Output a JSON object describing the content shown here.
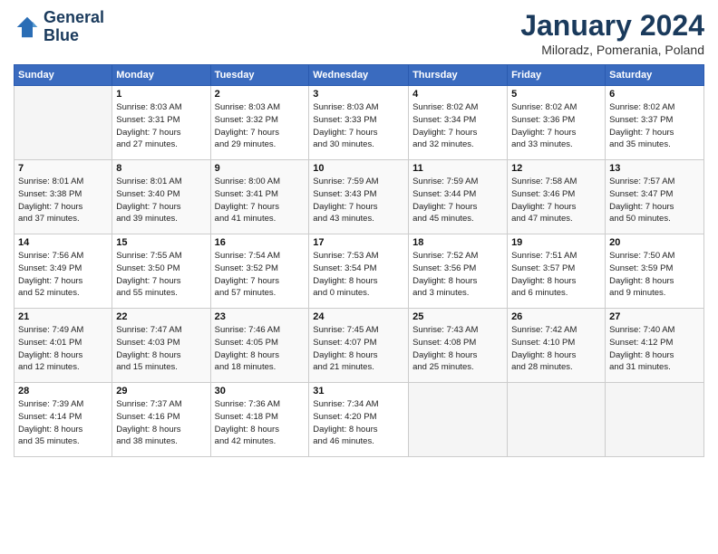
{
  "header": {
    "logo_line1": "General",
    "logo_line2": "Blue",
    "month": "January 2024",
    "location": "Miloradz, Pomerania, Poland"
  },
  "days_of_week": [
    "Sunday",
    "Monday",
    "Tuesday",
    "Wednesday",
    "Thursday",
    "Friday",
    "Saturday"
  ],
  "weeks": [
    [
      {
        "day": "",
        "info": ""
      },
      {
        "day": "1",
        "info": "Sunrise: 8:03 AM\nSunset: 3:31 PM\nDaylight: 7 hours\nand 27 minutes."
      },
      {
        "day": "2",
        "info": "Sunrise: 8:03 AM\nSunset: 3:32 PM\nDaylight: 7 hours\nand 29 minutes."
      },
      {
        "day": "3",
        "info": "Sunrise: 8:03 AM\nSunset: 3:33 PM\nDaylight: 7 hours\nand 30 minutes."
      },
      {
        "day": "4",
        "info": "Sunrise: 8:02 AM\nSunset: 3:34 PM\nDaylight: 7 hours\nand 32 minutes."
      },
      {
        "day": "5",
        "info": "Sunrise: 8:02 AM\nSunset: 3:36 PM\nDaylight: 7 hours\nand 33 minutes."
      },
      {
        "day": "6",
        "info": "Sunrise: 8:02 AM\nSunset: 3:37 PM\nDaylight: 7 hours\nand 35 minutes."
      }
    ],
    [
      {
        "day": "7",
        "info": "Sunrise: 8:01 AM\nSunset: 3:38 PM\nDaylight: 7 hours\nand 37 minutes."
      },
      {
        "day": "8",
        "info": "Sunrise: 8:01 AM\nSunset: 3:40 PM\nDaylight: 7 hours\nand 39 minutes."
      },
      {
        "day": "9",
        "info": "Sunrise: 8:00 AM\nSunset: 3:41 PM\nDaylight: 7 hours\nand 41 minutes."
      },
      {
        "day": "10",
        "info": "Sunrise: 7:59 AM\nSunset: 3:43 PM\nDaylight: 7 hours\nand 43 minutes."
      },
      {
        "day": "11",
        "info": "Sunrise: 7:59 AM\nSunset: 3:44 PM\nDaylight: 7 hours\nand 45 minutes."
      },
      {
        "day": "12",
        "info": "Sunrise: 7:58 AM\nSunset: 3:46 PM\nDaylight: 7 hours\nand 47 minutes."
      },
      {
        "day": "13",
        "info": "Sunrise: 7:57 AM\nSunset: 3:47 PM\nDaylight: 7 hours\nand 50 minutes."
      }
    ],
    [
      {
        "day": "14",
        "info": "Sunrise: 7:56 AM\nSunset: 3:49 PM\nDaylight: 7 hours\nand 52 minutes."
      },
      {
        "day": "15",
        "info": "Sunrise: 7:55 AM\nSunset: 3:50 PM\nDaylight: 7 hours\nand 55 minutes."
      },
      {
        "day": "16",
        "info": "Sunrise: 7:54 AM\nSunset: 3:52 PM\nDaylight: 7 hours\nand 57 minutes."
      },
      {
        "day": "17",
        "info": "Sunrise: 7:53 AM\nSunset: 3:54 PM\nDaylight: 8 hours\nand 0 minutes."
      },
      {
        "day": "18",
        "info": "Sunrise: 7:52 AM\nSunset: 3:56 PM\nDaylight: 8 hours\nand 3 minutes."
      },
      {
        "day": "19",
        "info": "Sunrise: 7:51 AM\nSunset: 3:57 PM\nDaylight: 8 hours\nand 6 minutes."
      },
      {
        "day": "20",
        "info": "Sunrise: 7:50 AM\nSunset: 3:59 PM\nDaylight: 8 hours\nand 9 minutes."
      }
    ],
    [
      {
        "day": "21",
        "info": "Sunrise: 7:49 AM\nSunset: 4:01 PM\nDaylight: 8 hours\nand 12 minutes."
      },
      {
        "day": "22",
        "info": "Sunrise: 7:47 AM\nSunset: 4:03 PM\nDaylight: 8 hours\nand 15 minutes."
      },
      {
        "day": "23",
        "info": "Sunrise: 7:46 AM\nSunset: 4:05 PM\nDaylight: 8 hours\nand 18 minutes."
      },
      {
        "day": "24",
        "info": "Sunrise: 7:45 AM\nSunset: 4:07 PM\nDaylight: 8 hours\nand 21 minutes."
      },
      {
        "day": "25",
        "info": "Sunrise: 7:43 AM\nSunset: 4:08 PM\nDaylight: 8 hours\nand 25 minutes."
      },
      {
        "day": "26",
        "info": "Sunrise: 7:42 AM\nSunset: 4:10 PM\nDaylight: 8 hours\nand 28 minutes."
      },
      {
        "day": "27",
        "info": "Sunrise: 7:40 AM\nSunset: 4:12 PM\nDaylight: 8 hours\nand 31 minutes."
      }
    ],
    [
      {
        "day": "28",
        "info": "Sunrise: 7:39 AM\nSunset: 4:14 PM\nDaylight: 8 hours\nand 35 minutes."
      },
      {
        "day": "29",
        "info": "Sunrise: 7:37 AM\nSunset: 4:16 PM\nDaylight: 8 hours\nand 38 minutes."
      },
      {
        "day": "30",
        "info": "Sunrise: 7:36 AM\nSunset: 4:18 PM\nDaylight: 8 hours\nand 42 minutes."
      },
      {
        "day": "31",
        "info": "Sunrise: 7:34 AM\nSunset: 4:20 PM\nDaylight: 8 hours\nand 46 minutes."
      },
      {
        "day": "",
        "info": ""
      },
      {
        "day": "",
        "info": ""
      },
      {
        "day": "",
        "info": ""
      }
    ]
  ]
}
